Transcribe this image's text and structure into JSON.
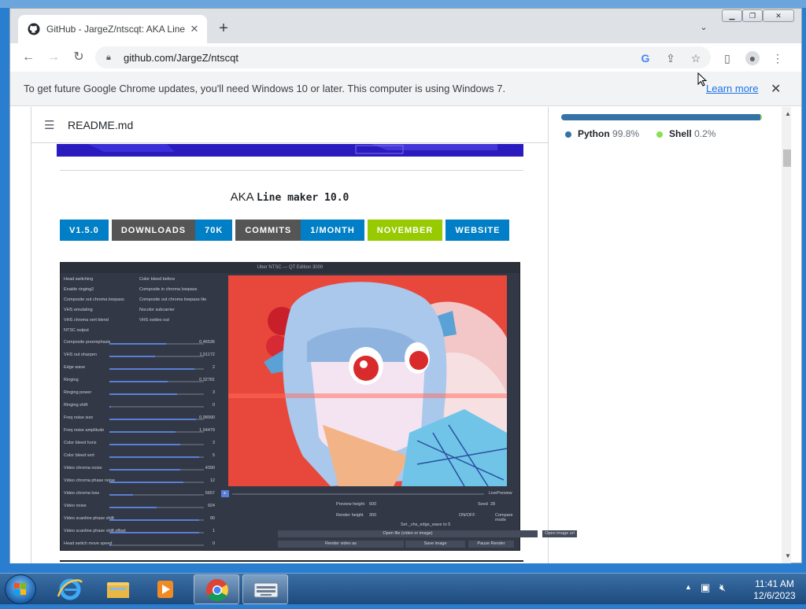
{
  "browser": {
    "tab_title": "GitHub - JargeZ/ntscqt: AKA Line",
    "url": "github.com/JargeZ/ntscqt",
    "infobar_message": "To get future Google Chrome updates, you'll need Windows 10 or later. This computer is using Windows 7.",
    "infobar_link": "Learn more"
  },
  "readme": {
    "filename": "README.md",
    "aka_prefix": "AKA",
    "aka_code": "Line maker 10.0",
    "badges": [
      {
        "left": "V1.5.0",
        "right": "",
        "left_color": "#007ec6",
        "right_color": ""
      },
      {
        "left": "DOWNLOADS",
        "right": "70K",
        "left_color": "#555555",
        "right_color": "#007ec6"
      },
      {
        "left": "COMMITS",
        "right": "1/MONTH",
        "left_color": "#555555",
        "right_color": "#007ec6"
      },
      {
        "left": "NOVEMBER",
        "right": "",
        "left_color": "#97ca00",
        "right_color": ""
      },
      {
        "left": "WEBSITE",
        "right": "",
        "left_color": "#007ec6",
        "right_color": ""
      }
    ],
    "screenshot": {
      "window_title": "Uber NTSC — QT Edition 3000",
      "checkboxes_left": [
        "Head switching",
        "Enable ringing2",
        "Composite out chroma lowpass",
        "VHS emulating",
        "VHS chroma vert blend",
        "NTSC output"
      ],
      "checkboxes_right": [
        "Color bleed before",
        "Composite in chroma lowpass",
        "Composite out chroma lowpass lite",
        "Nocolor subcarrier",
        "VHS svideo out"
      ],
      "sliders": [
        {
          "label": "Composite preemphasis",
          "value": "0.46536",
          "level": 0.6
        },
        {
          "label": "VHS out sharpen",
          "value": "1.51172",
          "level": 0.48
        },
        {
          "label": "Edge wave",
          "value": "2",
          "level": 0.9
        },
        {
          "label": "Ringing",
          "value": "0.32781",
          "level": 0.62
        },
        {
          "label": "Ringing power",
          "value": "3",
          "level": 0.72
        },
        {
          "label": "Ringing shift",
          "value": "0",
          "level": 0.02
        },
        {
          "label": "Freq noise size",
          "value": "0.98990",
          "level": 0.92
        },
        {
          "label": "Freq noise amplitude",
          "value": "1.54479",
          "level": 0.7
        },
        {
          "label": "Color bleed horiz",
          "value": "3",
          "level": 0.75
        },
        {
          "label": "Color bleed vert",
          "value": "5",
          "level": 0.95
        },
        {
          "label": "Video chroma noise",
          "value": "4390",
          "level": 0.75
        },
        {
          "label": "Video chroma phase noise",
          "value": "12",
          "level": 0.78
        },
        {
          "label": "Video chroma loss",
          "value": "5657",
          "level": 0.25
        },
        {
          "label": "Video noise",
          "value": "924",
          "level": 0.5
        },
        {
          "label": "Video scanline phase shift",
          "value": "90",
          "level": 0.95
        },
        {
          "label": "Video scanline phase shift offset",
          "value": "1",
          "level": 0.95
        },
        {
          "label": "Head switch move speed",
          "value": "0",
          "level": 0.02
        }
      ],
      "live_preview": "LivePreview",
      "preview_height_label": "Preview height",
      "preview_height_value": "600",
      "render_height_label": "Render height",
      "render_height_value": "300",
      "seed_label": "Seed",
      "seed_value": "28",
      "onoff": "ON/OFF",
      "compare_mode": "Compare mode",
      "status": "Set _vhs_edge_wave to 5",
      "open_btn": "Open file (video or image)",
      "open_image_url": "Open image url",
      "render_btn": "Render video as",
      "save_image_btn": "Save image",
      "pause_btn": "Pause Render"
    }
  },
  "languages": [
    {
      "name": "Python",
      "pct": "99.8%",
      "color": "#3572a5"
    },
    {
      "name": "Shell",
      "pct": "0.2%",
      "color": "#89e051"
    }
  ],
  "taskbar": {
    "time": "11:41 AM",
    "date": "12/6/2023"
  }
}
